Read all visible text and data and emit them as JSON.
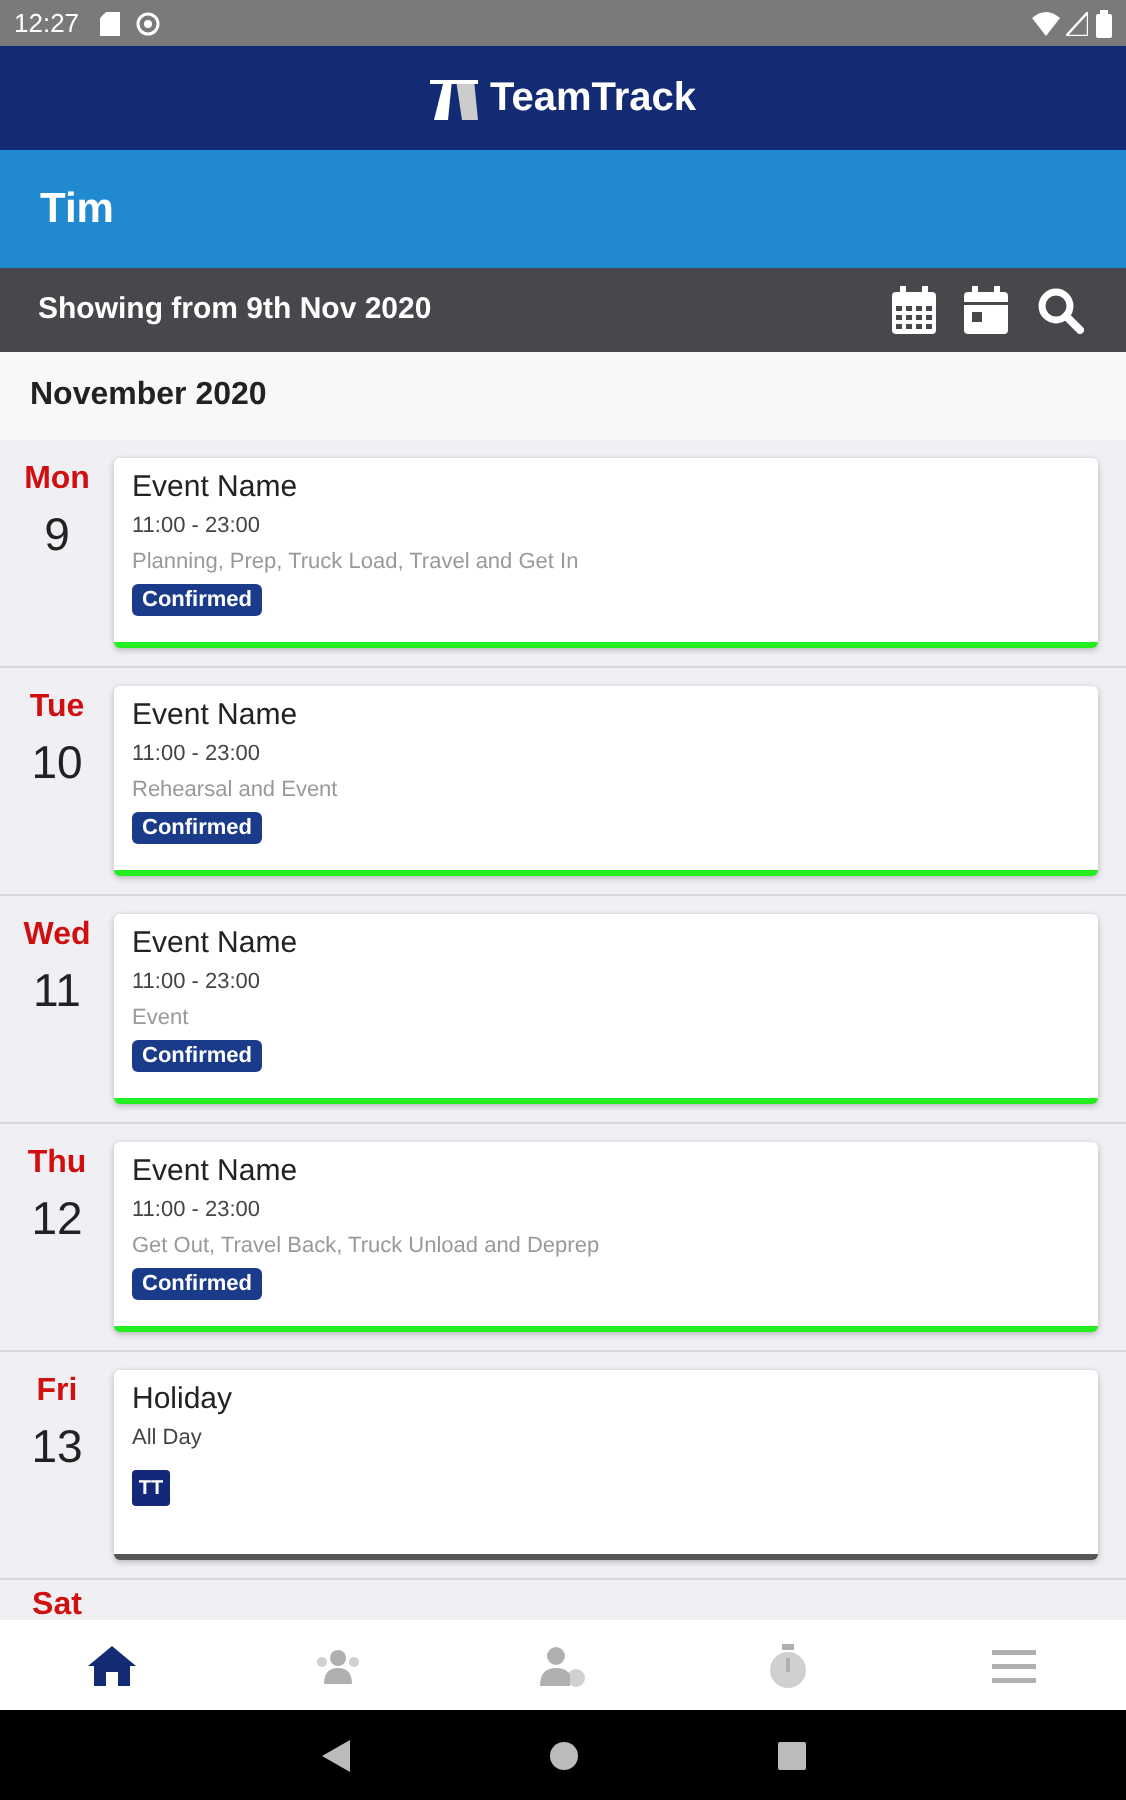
{
  "status_bar": {
    "time": "12:27"
  },
  "app": {
    "logo_text": "TeamTrack"
  },
  "user": {
    "name": "Tim"
  },
  "filter_bar": {
    "label": "Showing from 9th Nov 2020"
  },
  "month": "November 2020",
  "days": [
    {
      "weekday": "Mon",
      "date": "9",
      "event": {
        "title": "Event Name",
        "time": "11:00 - 23:00",
        "description": "Planning, Prep, Truck Load, Travel and Get In",
        "badge": {
          "kind": "status",
          "text": "Confirmed"
        },
        "color": "#22ee22"
      }
    },
    {
      "weekday": "Tue",
      "date": "10",
      "event": {
        "title": "Event Name",
        "time": "11:00 - 23:00",
        "description": "Rehearsal and Event",
        "badge": {
          "kind": "status",
          "text": "Confirmed"
        },
        "color": "#22ee22"
      }
    },
    {
      "weekday": "Wed",
      "date": "11",
      "event": {
        "title": "Event Name",
        "time": "11:00 - 23:00",
        "description": "Event",
        "badge": {
          "kind": "status",
          "text": "Confirmed"
        },
        "color": "#22ee22"
      }
    },
    {
      "weekday": "Thu",
      "date": "12",
      "event": {
        "title": "Event Name",
        "time": "11:00 - 23:00",
        "description": "Get Out, Travel Back, Truck Unload and Deprep",
        "badge": {
          "kind": "status",
          "text": "Confirmed"
        },
        "color": "#22ee22"
      }
    },
    {
      "weekday": "Fri",
      "date": "13",
      "event": {
        "title": "Holiday",
        "time": "All Day",
        "badge": {
          "kind": "logo",
          "text": "TT"
        },
        "color": "#555555"
      }
    },
    {
      "weekday": "Sat"
    }
  ],
  "bottom_nav": [
    {
      "kind": "home",
      "selected": true
    },
    {
      "kind": "team",
      "selected": false
    },
    {
      "kind": "person-clock",
      "selected": false
    },
    {
      "kind": "stopwatch",
      "selected": false
    },
    {
      "kind": "menu",
      "selected": false
    }
  ]
}
